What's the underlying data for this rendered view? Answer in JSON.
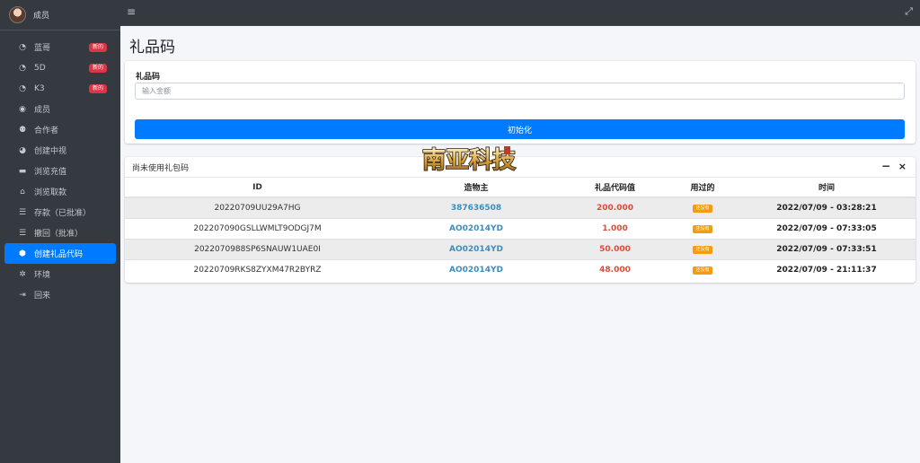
{
  "sidebar": {
    "user_name": "成员",
    "items": [
      {
        "label": "蓝哥",
        "icon": "tachometer-icon",
        "glyph": "◔",
        "badge": "新的"
      },
      {
        "label": "5D",
        "icon": "tachometer-icon",
        "glyph": "◔",
        "badge": "新的"
      },
      {
        "label": "K3",
        "icon": "tachometer-icon",
        "glyph": "◔",
        "badge": "新的"
      },
      {
        "label": "成员",
        "icon": "user-circle-icon",
        "glyph": "◉",
        "badge": ""
      },
      {
        "label": "合作者",
        "icon": "users-icon",
        "glyph": "⚉",
        "badge": ""
      },
      {
        "label": "创建中视",
        "icon": "pie-chart-icon",
        "glyph": "◕",
        "badge": ""
      },
      {
        "label": "浏览充值",
        "icon": "credit-card-icon",
        "glyph": "▬",
        "badge": ""
      },
      {
        "label": "浏览取款",
        "icon": "bank-icon",
        "glyph": "⌂",
        "badge": ""
      },
      {
        "label": "存款（已批准）",
        "icon": "list-icon",
        "glyph": "☰",
        "badge": ""
      },
      {
        "label": "撤回（批准）",
        "icon": "list-icon",
        "glyph": "☰",
        "badge": ""
      },
      {
        "label": "创建礼品代码",
        "icon": "gift-icon",
        "glyph": "⬢",
        "badge": "",
        "active": true
      },
      {
        "label": "环境",
        "icon": "gear-icon",
        "glyph": "✲",
        "badge": ""
      },
      {
        "label": "回来",
        "icon": "sign-out-icon",
        "glyph": "⇥",
        "badge": ""
      }
    ]
  },
  "topbar": {
    "menu_glyph": "≡",
    "fullscreen_glyph": "⤢"
  },
  "page": {
    "title": "礼品码"
  },
  "form": {
    "label": "礼品码",
    "placeholder": "输入金额",
    "button_label": "初始化"
  },
  "table_card": {
    "title": "尚未使用礼包码",
    "minimize_glyph": "−",
    "close_glyph": "×",
    "columns": [
      "ID",
      "造物主",
      "礼品代码值",
      "用过的",
      "时间"
    ],
    "rows": [
      {
        "id": "20220709UU29A7HG",
        "owner": "387636508",
        "value": "200.000",
        "used": "还没有",
        "time": "2022/07/09 - 03:28:21"
      },
      {
        "id": "202207090GSLLWMLT9ODGJ7M",
        "owner": "AO02014YD",
        "value": "1.000",
        "used": "还没有",
        "time": "2022/07/09 - 07:33:05"
      },
      {
        "id": "2022070988SP6SNAUW1UAE0I",
        "owner": "AO02014YD",
        "value": "50.000",
        "used": "还没有",
        "time": "2022/07/09 - 07:33:51"
      },
      {
        "id": "20220709RKS8ZYXM47R2BYRZ",
        "owner": "AO02014YD",
        "value": "48.000",
        "used": "还没有",
        "time": "2022/07/09 - 21:11:37"
      }
    ]
  },
  "watermark": {
    "text": "南亚科技"
  },
  "colors": {
    "sidebar_bg": "#343a40",
    "accent": "#007bff",
    "badge_new": "#dc3545",
    "owner_link": "#3c8dbc",
    "value_red": "#dd4b39",
    "used_badge": "#f39c12"
  }
}
